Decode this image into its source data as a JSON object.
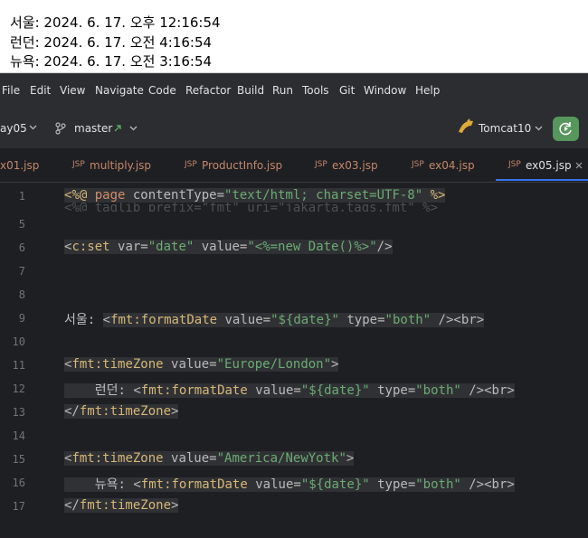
{
  "output": {
    "lines": [
      "서울: 2024. 6. 17. 오후 12:16:54",
      "런던: 2024. 6. 17. 오전 4:16:54",
      "뉴욕: 2024. 6. 17. 오전 3:16:54"
    ]
  },
  "menu": {
    "items": [
      "File",
      "Edit",
      "View",
      "Navigate",
      "Code",
      "Refactor",
      "Build",
      "Run",
      "Tools",
      "Git",
      "Window",
      "Help"
    ]
  },
  "toolbar": {
    "project": "ay05",
    "branch": "master",
    "run_config": "Tomcat10"
  },
  "tabs": [
    {
      "icon": "JSP",
      "label": "x01.jsp"
    },
    {
      "icon": "JSP",
      "label": "multiply.jsp"
    },
    {
      "icon": "JSP",
      "label": "ProductInfo.jsp"
    },
    {
      "icon": "JSP",
      "label": "ex03.jsp"
    },
    {
      "icon": "JSP",
      "label": "ex04.jsp"
    },
    {
      "icon": "JSP",
      "label": "ex05.jsp",
      "active": true
    }
  ],
  "editor": {
    "line_numbers": [
      "1",
      "5",
      "6",
      "7",
      "8",
      "9",
      "10",
      "11",
      "12",
      "13",
      "14",
      "15",
      "16",
      "17"
    ],
    "line1": {
      "a": "<%@ ",
      "b": "page",
      "c": " contentType=",
      "d": "\"text/html; charset=UTF-8\"",
      "e": " %>"
    },
    "ghost": "<%@ taglib prefix=\"fmt\" uri=\"jakarta.tags.fmt\" %>",
    "line6": {
      "a": "<",
      "b": "c:set",
      "c": " var=",
      "d": "\"date\"",
      "e": " value=",
      "f": "\"<%=new Date()%>\"",
      "g": "/>"
    },
    "line9": {
      "label": "서울: ",
      "a": "<",
      "b": "fmt:formatDate",
      "c": " value=",
      "d": "\"${date}\"",
      "e": " type=",
      "f": "\"both\"",
      "g": " />",
      "h": "<br>"
    },
    "line11": {
      "a": "<",
      "b": "fmt:timeZone",
      "c": " value=",
      "d": "\"Europe/London\"",
      "e": ">"
    },
    "line12": {
      "label": "    런던: ",
      "a": "<",
      "b": "fmt:formatDate",
      "c": " value=",
      "d": "\"${date}\"",
      "e": " type=",
      "f": "\"both\"",
      "g": " />",
      "h": "<br>"
    },
    "line13": {
      "a": "</",
      "b": "fmt:timeZone",
      "c": ">"
    },
    "line15": {
      "a": "<",
      "b": "fmt:timeZone",
      "c": " value=",
      "d": "\"America/NewYotk\"",
      "e": ">"
    },
    "line16": {
      "label": "    뉴욕: ",
      "a": "<",
      "b": "fmt:formatDate",
      "c": " value=",
      "d": "\"${date}\"",
      "e": " type=",
      "f": "\"both\"",
      "g": " />",
      "h": "<br>"
    },
    "line17": {
      "a": "</",
      "b": "fmt:timeZone",
      "c": ">"
    }
  }
}
